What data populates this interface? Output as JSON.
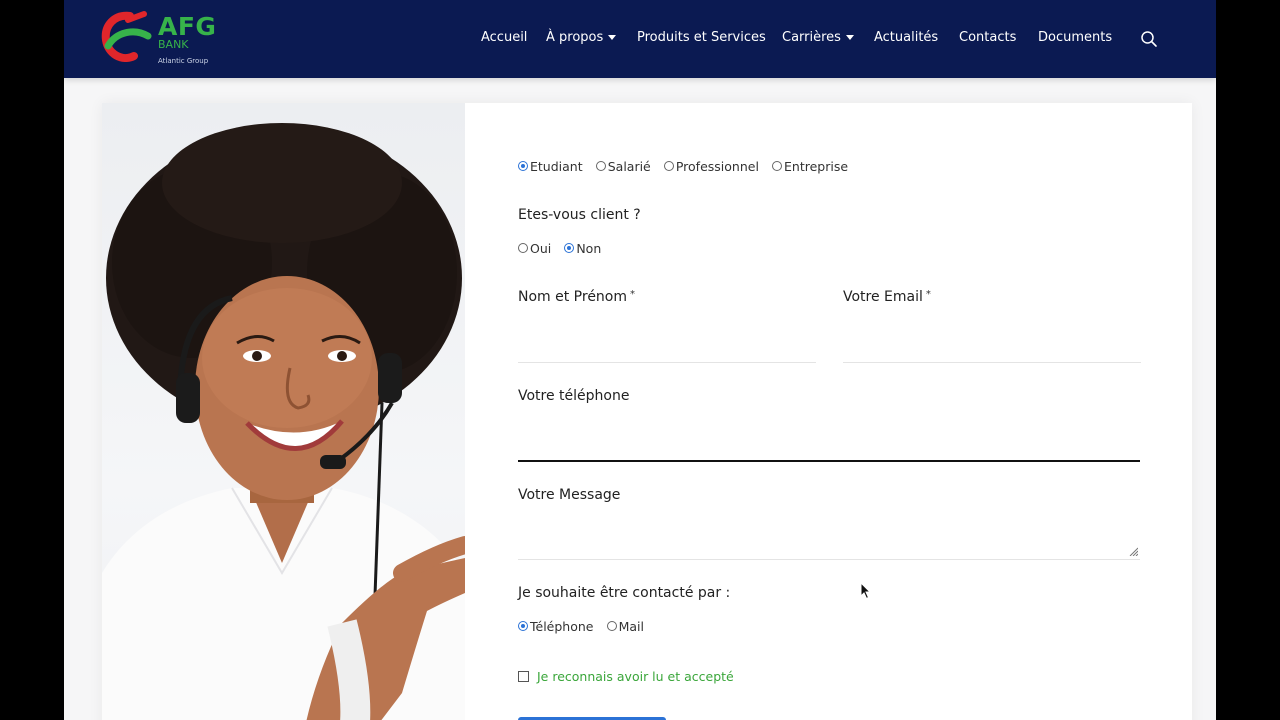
{
  "brand": {
    "name": "AFG",
    "sub": "BANK",
    "tagline": "Atlantic Group",
    "colors": {
      "green": "#37b34a",
      "red": "#e0262b",
      "navy": "#0b1a52"
    }
  },
  "nav": {
    "items": [
      {
        "label": "Accueil",
        "dropdown": false
      },
      {
        "label": "À propos",
        "dropdown": true
      },
      {
        "label": "Produits et Services",
        "dropdown": false
      },
      {
        "label": "Carrières",
        "dropdown": true
      },
      {
        "label": "Actualités",
        "dropdown": false
      },
      {
        "label": "Contacts",
        "dropdown": false
      },
      {
        "label": "Documents",
        "dropdown": false
      }
    ],
    "search_icon": "search-icon"
  },
  "form": {
    "profile": {
      "options": [
        "Etudiant",
        "Salarié",
        "Professionnel",
        "Entreprise"
      ],
      "selected": "Etudiant"
    },
    "client": {
      "question": "Etes-vous client ?",
      "options": [
        "Oui",
        "Non"
      ],
      "selected": "Non"
    },
    "name_label": "Nom et Prénom",
    "email_label": "Votre Email",
    "required_mark": "*",
    "phone_label": "Votre téléphone",
    "message_label": "Votre Message",
    "contact_by": {
      "question": "Je souhaite être contacté par :",
      "options": [
        "Téléphone",
        "Mail"
      ],
      "selected": "Téléphone"
    },
    "accept_label": "Je reconnais avoir lu et accepté",
    "accept_checked": false
  },
  "accent_color": "#2b72d6"
}
